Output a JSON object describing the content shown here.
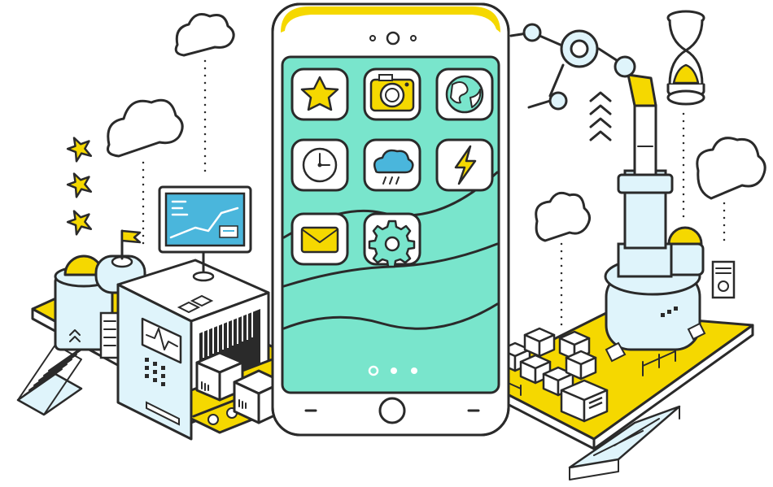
{
  "colors": {
    "accent_yellow": "#f5d800",
    "screen_teal": "#79e5cc",
    "light_blue": "#dff4fb",
    "monitor_blue": "#4ab6dc",
    "outline": "#2a2a2a",
    "background": "#ffffff"
  },
  "phone": {
    "camera_icon": "camera-dot-icon",
    "speaker_icon": "speaker-dot-icon",
    "home_button_icon": "home-button-icon",
    "page_indicator": {
      "pages": 3
    }
  },
  "apps": [
    {
      "icon": "star-icon"
    },
    {
      "icon": "camera-icon"
    },
    {
      "icon": "globe-icon"
    },
    {
      "icon": "clock-icon"
    },
    {
      "icon": "weather-cloud-icon"
    },
    {
      "icon": "lightning-icon"
    },
    {
      "icon": "mail-icon"
    },
    {
      "icon": "gear-icon"
    }
  ],
  "scene_elements": {
    "left_factory": [
      "monitor-icon",
      "tank-icon",
      "flag-icon",
      "conveyor-belt-icon",
      "box-icon",
      "staircase-icon"
    ],
    "right_factory": [
      "robot-arm-icon",
      "hourglass-icon",
      "machine-icon",
      "boxes-icon",
      "chevrons-up-icon",
      "ramp-icon"
    ],
    "sky": [
      "cloud-icon",
      "star-icon"
    ]
  }
}
